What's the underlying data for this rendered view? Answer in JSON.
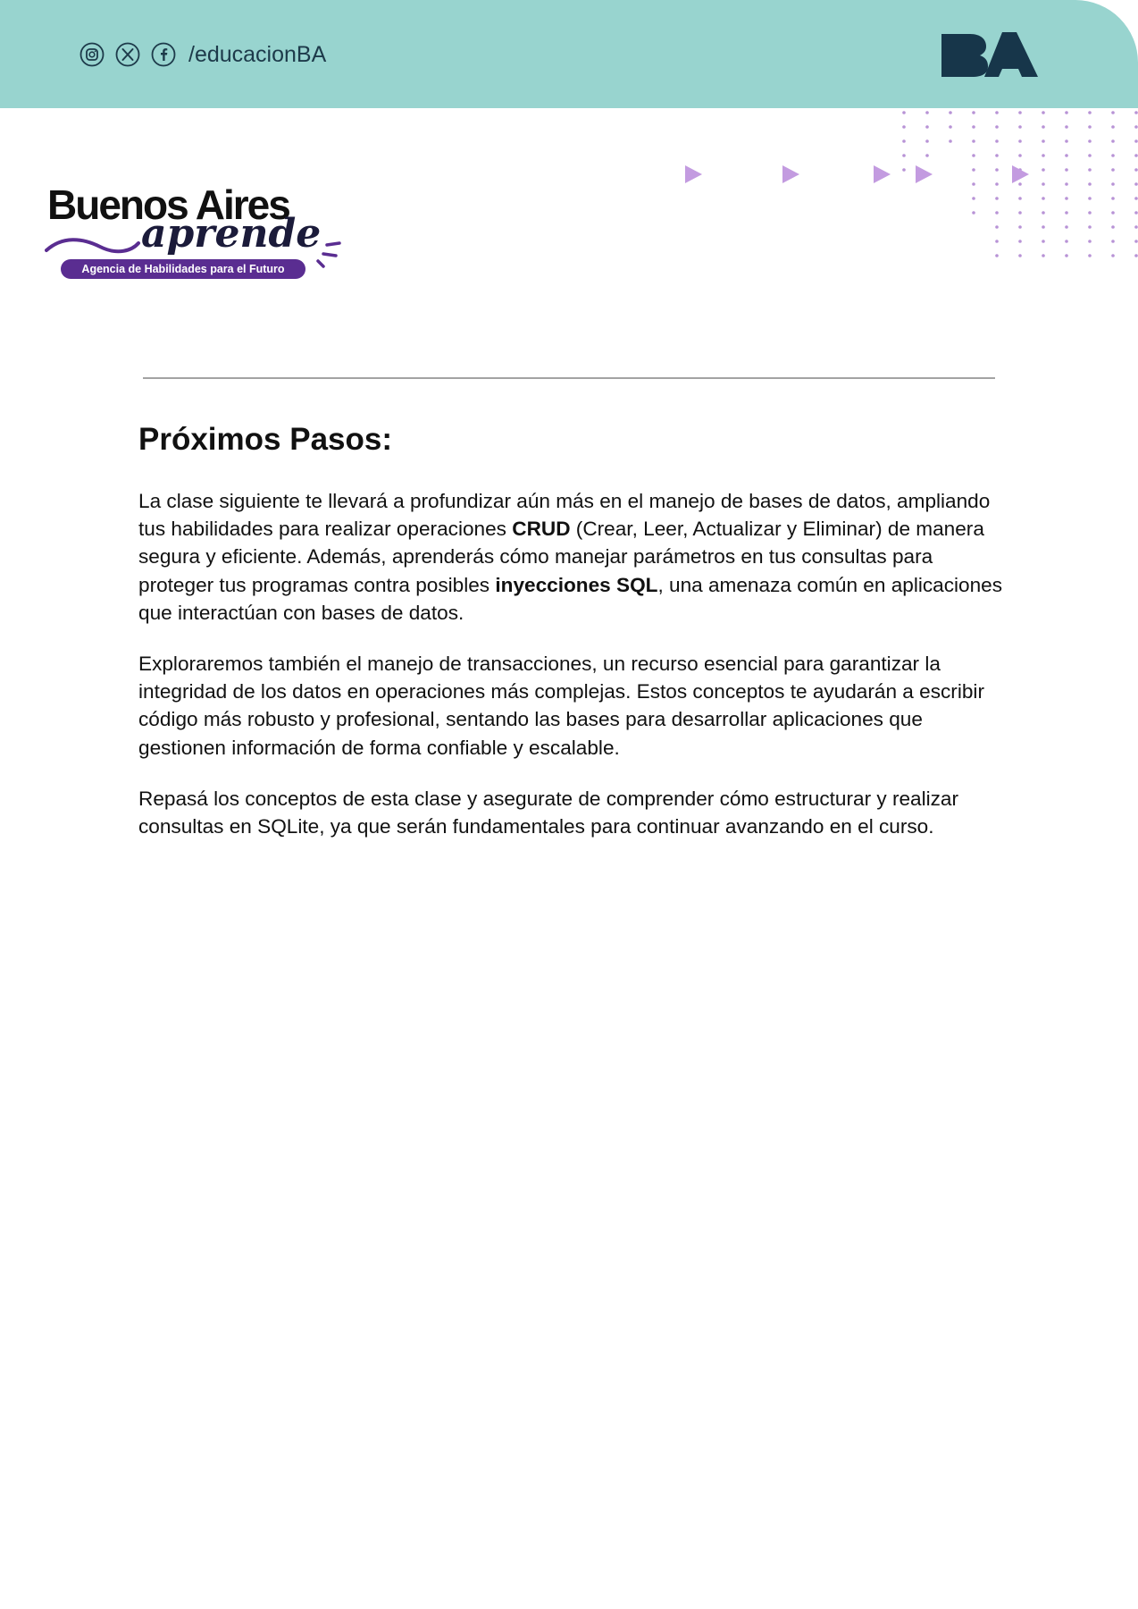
{
  "header": {
    "social_handle": "/educacionBA",
    "icons": [
      "instagram-icon",
      "x-icon",
      "facebook-icon"
    ],
    "band_color": "#98d4cf",
    "logo_text": "BA",
    "logo_color": "#17364a"
  },
  "brand": {
    "line1": "Buenos Aires",
    "line2": "aprende",
    "tagline": "Agencia de Habilidades para el Futuro",
    "accent": "#5a2d91"
  },
  "section": {
    "title": "Próximos Pasos:",
    "p1": {
      "a": "La clase siguiente te llevará a profundizar aún más en el manejo de bases de datos, ampliando tus habilidades para realizar operaciones ",
      "b1": "CRUD",
      "c": " (Crear, Leer, Actualizar y Eliminar) de manera segura y eficiente. Además, aprenderás cómo manejar parámetros en tus consultas para proteger tus programas contra posibles ",
      "b2": "inyecciones SQL",
      "d": ", una amenaza común en aplicaciones que interactúan con bases de datos."
    },
    "p2": "Exploraremos también el manejo de transacciones, un recurso esencial para garantizar la integridad de los datos en operaciones más complejas. Estos conceptos te ayudarán a escribir código más robusto y profesional, sentando las bases para desarrollar aplicaciones que gestionen información de forma confiable y escalable.",
    "p3": "Repasá los conceptos de esta clase y asegurate de comprender cómo estructurar y realizar consultas en SQLite, ya que serán fundamentales para continuar avanzando en el curso."
  }
}
